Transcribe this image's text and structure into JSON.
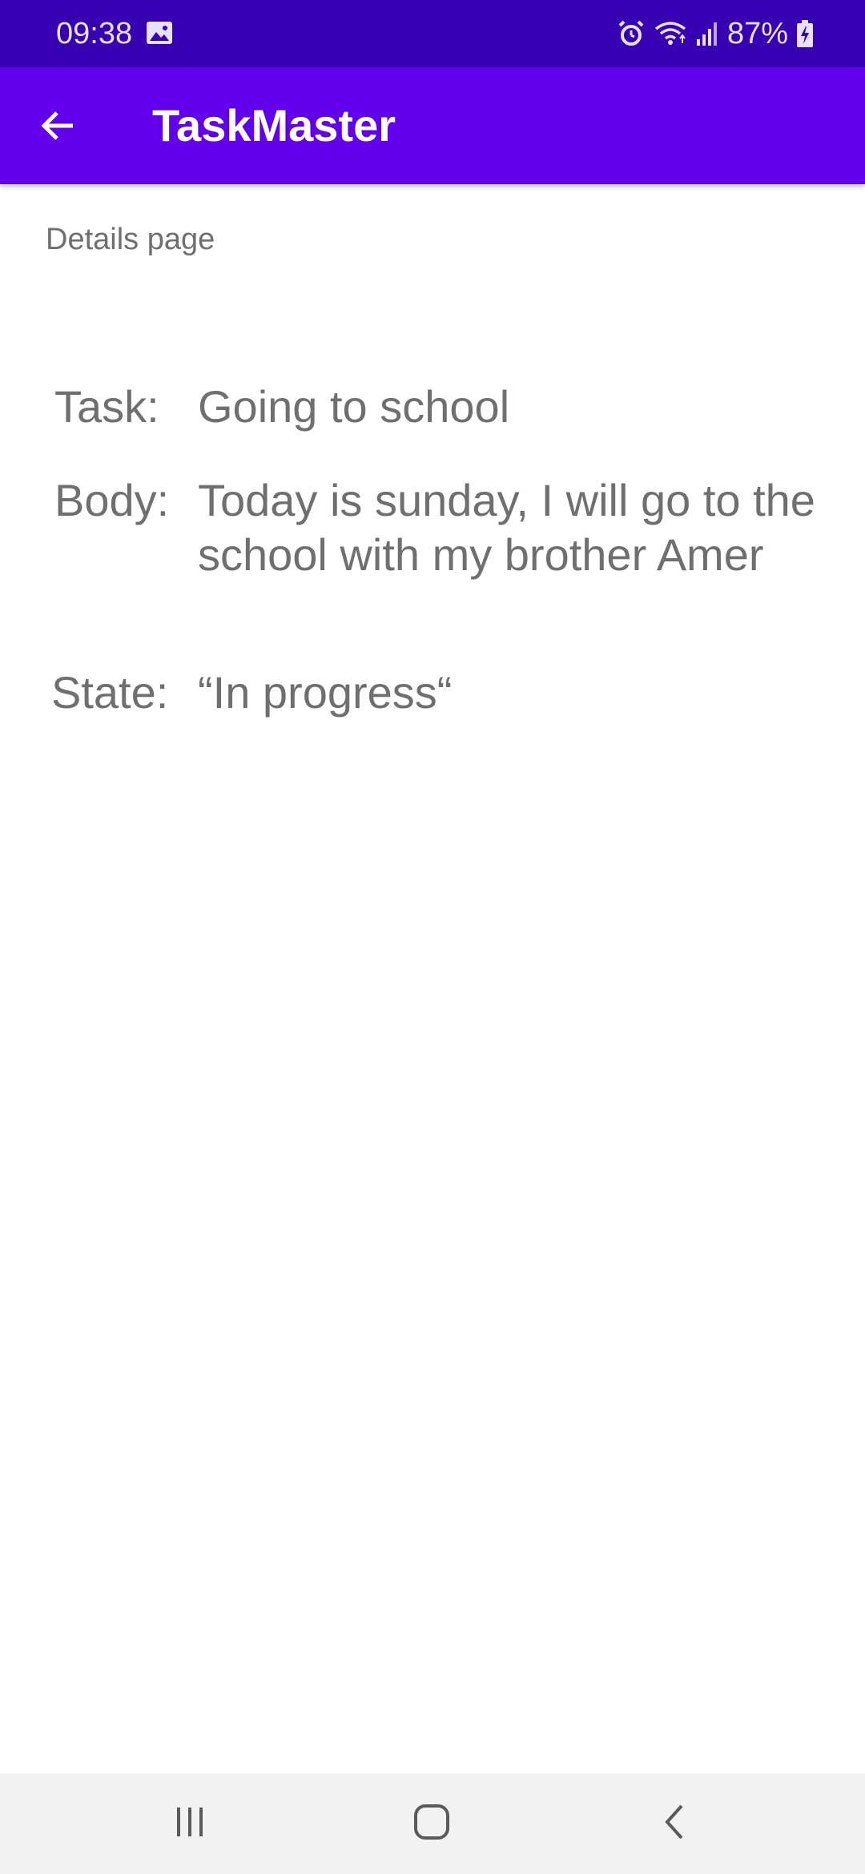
{
  "status_bar": {
    "time": "09:38",
    "battery_percent": "87%",
    "icons": [
      "image-icon",
      "alarm-icon",
      "wifi-icon",
      "signal-icon",
      "battery-charging-icon"
    ]
  },
  "app_bar": {
    "title": "TaskMaster",
    "back_icon": "arrow-back-icon",
    "color": "#6200ee",
    "status_color": "#3700b3"
  },
  "page": {
    "label": "Details page"
  },
  "details": {
    "task_label": "Task:",
    "task_value": "Going to school",
    "body_label": "Body:",
    "body_value": "Today is sunday, I will go to the school with my brother Amer",
    "state_label": "State:",
    "state_value": "“In progress“"
  },
  "nav_bar": {
    "icons": [
      "recent-apps-icon",
      "home-icon",
      "back-icon"
    ]
  }
}
